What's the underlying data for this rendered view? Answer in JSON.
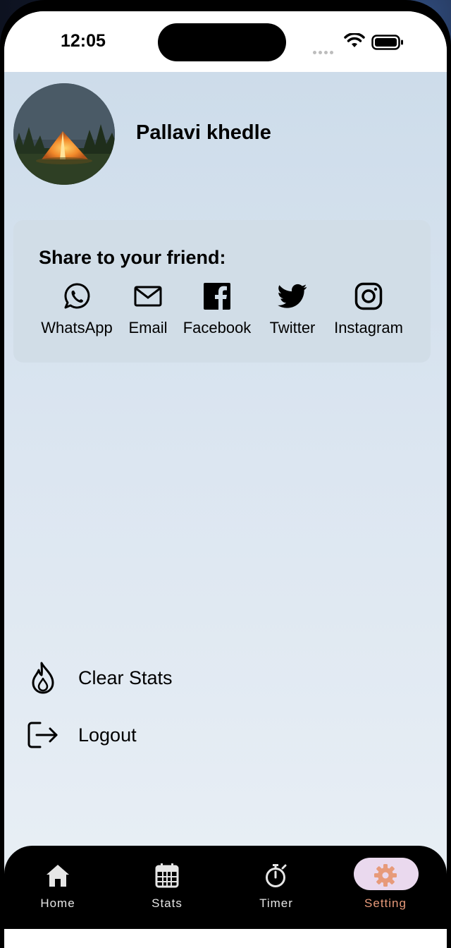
{
  "status_bar": {
    "time": "12:05"
  },
  "profile": {
    "name": "Pallavi khedle"
  },
  "share": {
    "title": "Share to your friend:",
    "items": [
      {
        "label": "WhatsApp",
        "icon": "whatsapp-icon"
      },
      {
        "label": "Email",
        "icon": "email-icon"
      },
      {
        "label": "Facebook",
        "icon": "facebook-icon"
      },
      {
        "label": "Twitter",
        "icon": "twitter-icon"
      },
      {
        "label": "Instagram",
        "icon": "instagram-icon"
      }
    ]
  },
  "menu": [
    {
      "label": "Clear Stats",
      "icon": "flame-icon"
    },
    {
      "label": "Logout",
      "icon": "logout-icon"
    }
  ],
  "tabs": [
    {
      "label": "Home",
      "icon": "home-icon"
    },
    {
      "label": "Stats",
      "icon": "calendar-icon"
    },
    {
      "label": "Timer",
      "icon": "stopwatch-icon"
    },
    {
      "label": "Setting",
      "icon": "gear-icon",
      "active": true
    }
  ],
  "colors": {
    "accent": "#e79a7a",
    "active_pill": "#ead9ee",
    "tab_bar": "#000000",
    "card": "#d1dde7"
  }
}
